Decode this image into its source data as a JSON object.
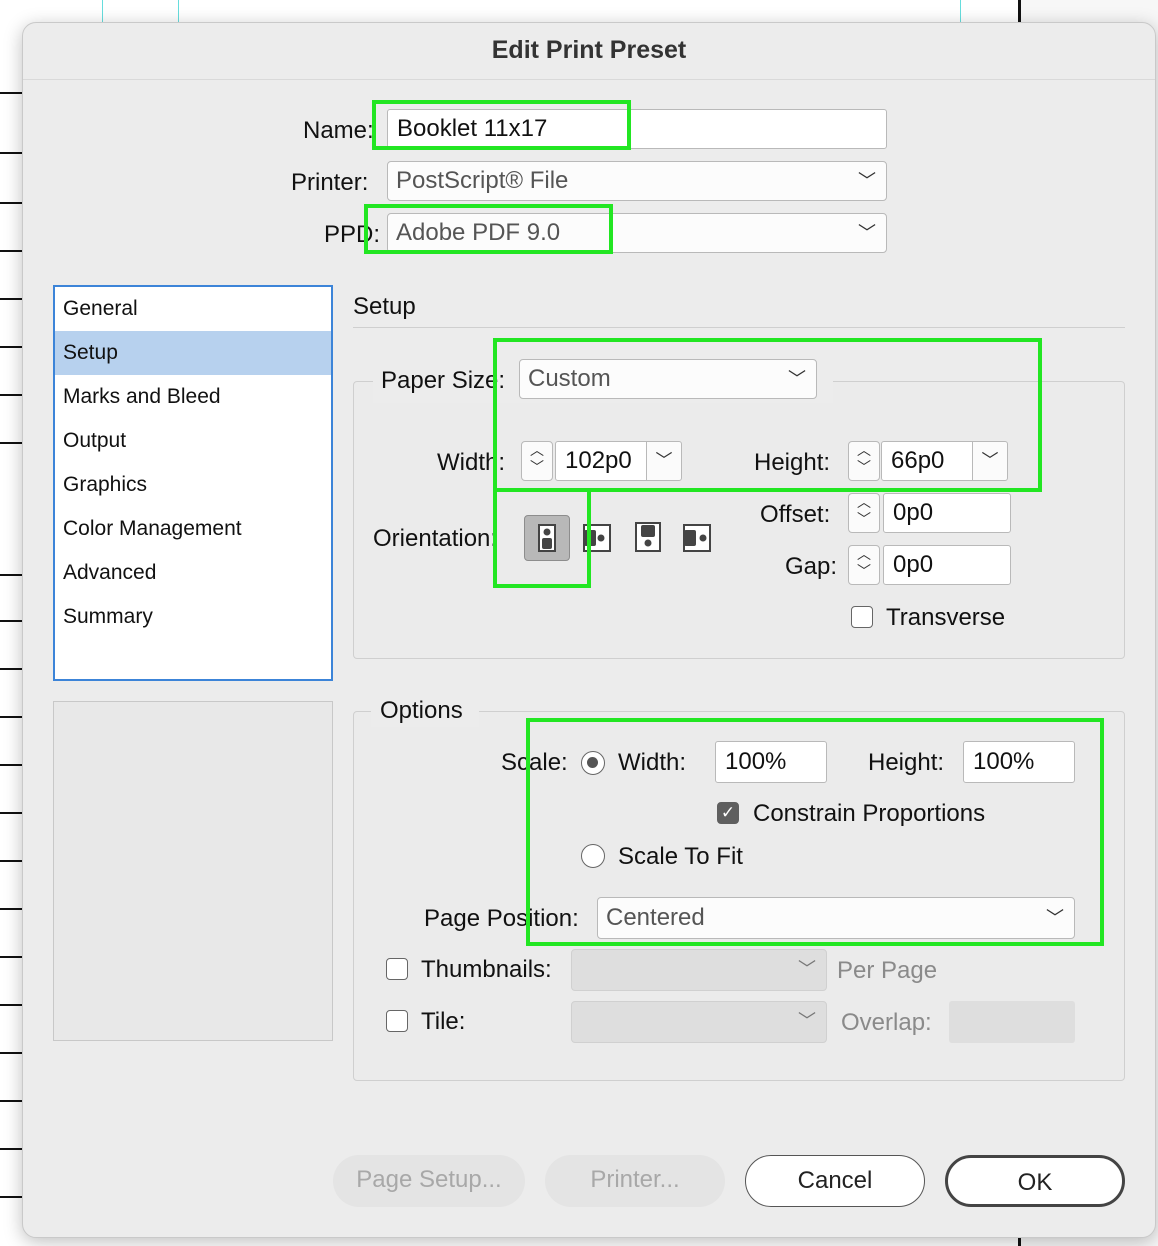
{
  "dialog": {
    "title": "Edit Print Preset"
  },
  "top": {
    "name_label": "Name:",
    "name_value": "Booklet 11x17",
    "printer_label": "Printer:",
    "printer_value": "PostScript® File",
    "ppd_label": "PPD:",
    "ppd_value": "Adobe PDF 9.0"
  },
  "sidebar": {
    "items": [
      {
        "label": "General"
      },
      {
        "label": "Setup",
        "selected": true
      },
      {
        "label": "Marks and Bleed"
      },
      {
        "label": "Output"
      },
      {
        "label": "Graphics"
      },
      {
        "label": "Color Management"
      },
      {
        "label": "Advanced"
      },
      {
        "label": "Summary"
      }
    ]
  },
  "setup": {
    "heading": "Setup",
    "paper_size_label": "Paper Size:",
    "paper_size_value": "Custom",
    "width_label": "Width:",
    "width_value": "102p0",
    "height_label": "Height:",
    "height_value": "66p0",
    "orientation_label": "Orientation:",
    "offset_label": "Offset:",
    "offset_value": "0p0",
    "gap_label": "Gap:",
    "gap_value": "0p0",
    "transverse_label": "Transverse"
  },
  "options": {
    "heading": "Options",
    "scale_label": "Scale:",
    "scale_width_label": "Width:",
    "scale_width_value": "100%",
    "scale_height_label": "Height:",
    "scale_height_value": "100%",
    "constrain_label": "Constrain Proportions",
    "scale_to_fit_label": "Scale To Fit",
    "page_position_label": "Page Position:",
    "page_position_value": "Centered",
    "thumbnails_label": "Thumbnails:",
    "per_page_label": "Per Page",
    "tile_label": "Tile:",
    "overlap_label": "Overlap:"
  },
  "buttons": {
    "page_setup": "Page Setup...",
    "printer": "Printer...",
    "cancel": "Cancel",
    "ok": "OK"
  },
  "colors": {
    "highlight": "#22e622",
    "sidebar_selection": "#b7d1ee",
    "sidebar_border": "#3c84d8"
  }
}
